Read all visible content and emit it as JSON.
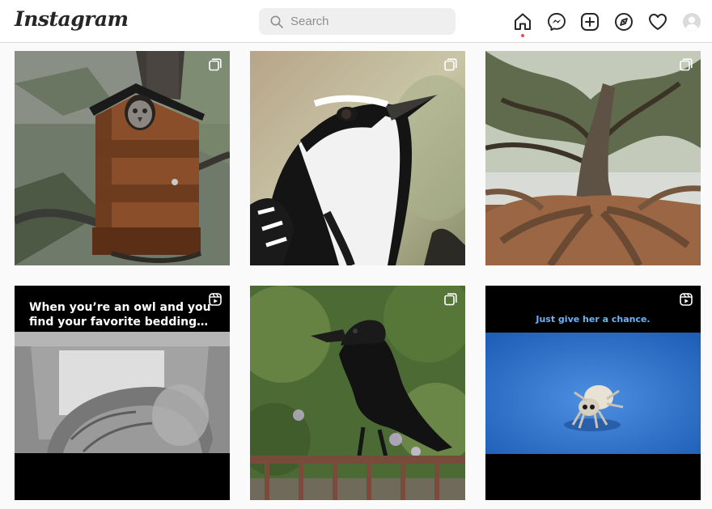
{
  "app": {
    "logo_text": "Instagram"
  },
  "search": {
    "placeholder": "Search",
    "value": ""
  },
  "nav": {
    "items": [
      {
        "name": "home",
        "icon": "home-icon",
        "active": true
      },
      {
        "name": "messenger",
        "icon": "messenger-icon"
      },
      {
        "name": "new-post",
        "icon": "plus-square-icon"
      },
      {
        "name": "explore",
        "icon": "compass-icon"
      },
      {
        "name": "activity",
        "icon": "heart-icon"
      },
      {
        "name": "profile",
        "icon": "avatar-icon"
      }
    ]
  },
  "posts": [
    {
      "id": "owl-birdhouse",
      "badge": "carousel-icon"
    },
    {
      "id": "woodpecker",
      "badge": "carousel-icon"
    },
    {
      "id": "tree-roots",
      "badge": "carousel-icon"
    },
    {
      "id": "owl-bedding",
      "badge": "reel-icon",
      "caption_line1": "When you’re an owl and you",
      "caption_line2": "find your favorite bedding…"
    },
    {
      "id": "crow",
      "badge": "carousel-icon"
    },
    {
      "id": "jumping-spider",
      "badge": "reel-icon",
      "caption": "Just give her a chance."
    }
  ],
  "colors": {
    "notification_dot": "#ed4956",
    "caption_blue": "#6ab3ff"
  }
}
